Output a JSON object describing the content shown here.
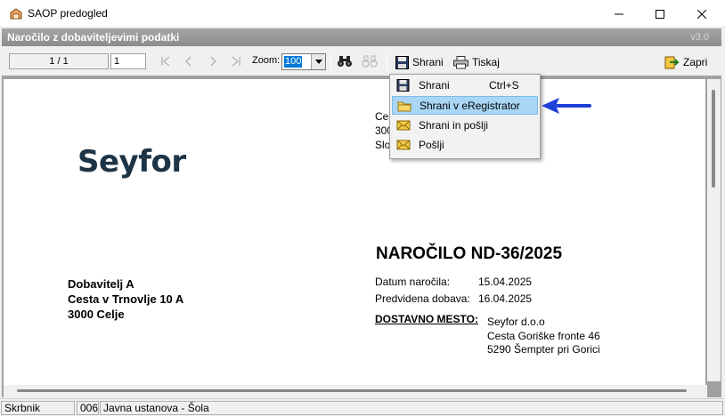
{
  "window": {
    "title": "SAOP predogled",
    "controls": [
      "minimize-icon",
      "maximize-icon",
      "close-icon"
    ]
  },
  "header": {
    "title": "Naročilo z dobaviteljevimi podatki",
    "version": "v3.0"
  },
  "toolbar": {
    "page_counter": "1 / 1",
    "page_input": "1",
    "nav_icons": [
      "first-page-icon",
      "previous-page-icon",
      "next-page-icon",
      "last-page-icon"
    ],
    "zoom_label": "Zoom:",
    "zoom_value": "100",
    "find_icons": [
      "binoculars-icon",
      "find-next-icon"
    ],
    "save_label": "Shrani",
    "print_label": "Tiskaj",
    "close_label": "Zapri"
  },
  "menu": {
    "items": [
      {
        "label": "Shrani",
        "shortcut": "Ctrl+S",
        "icon": "floppy-disk-icon",
        "highlighted": false
      },
      {
        "label": "Shrani v eRegistrator",
        "shortcut": "",
        "icon": "folder-icon",
        "highlighted": true
      },
      {
        "label": "Shrani in pošlji",
        "shortcut": "",
        "icon": "envelope-icon",
        "highlighted": false
      },
      {
        "label": "Pošlji",
        "shortcut": "",
        "icon": "envelope-icon",
        "highlighted": false
      }
    ]
  },
  "document": {
    "logo": "Seyfor",
    "partial_lines": [
      "Cel",
      "300",
      "Slo"
    ],
    "supplier": {
      "name": "Dobavitelj A",
      "street": "Cesta v Trnovlje 10 A",
      "city": "3000 Celje"
    },
    "order_title": "NAROČILO ND-36/2025",
    "fields": [
      {
        "label": "Datum naročila:",
        "value": "15.04.2025"
      },
      {
        "label": "Predvidena dobava:",
        "value": "16.04.2025"
      }
    ],
    "delivery": {
      "label": "DOSTAVNO MESTO:",
      "lines": [
        "Seyfor d.o.o",
        "Cesta Goriške fronte 46",
        "5290 Šempter pri Gorici"
      ]
    }
  },
  "status": {
    "cells": [
      "Skrbnik",
      "006",
      "Javna ustanova - Šola"
    ]
  },
  "colors": {
    "logo": "#1d3446",
    "menu_highlight": "#a9d6f5",
    "arrow": "#1f3fd9",
    "header_gradient": "#999999"
  }
}
